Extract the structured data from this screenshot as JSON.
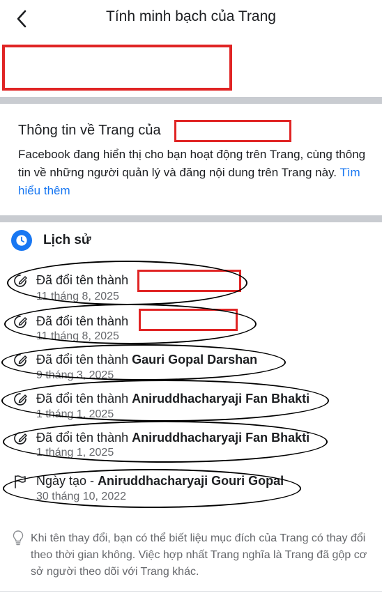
{
  "header": {
    "title": "Tính minh bạch của Trang",
    "back_icon": "chevron-left-icon"
  },
  "page_info": {
    "title_prefix": "Thông tin về Trang của",
    "description": "Facebook đang hiển thị cho bạn hoạt động trên Trang, cùng thông tin về những người quản lý và đăng nội dung trên Trang này.",
    "learn_more": "Tìm hiểu thêm"
  },
  "history": {
    "title": "Lịch sử",
    "icon": "clock-icon",
    "items": [
      {
        "prefix": "Đã đổi tên thành",
        "name": "",
        "date": "11 tháng 8, 2025",
        "icon": "rename-icon"
      },
      {
        "prefix": "Đã đổi tên thành",
        "name": "",
        "date": "11 tháng 8, 2025",
        "icon": "rename-icon"
      },
      {
        "prefix": "Đã đổi tên thành",
        "name": "Gauri Gopal Darshan",
        "date": "9 tháng 3, 2025",
        "icon": "rename-icon"
      },
      {
        "prefix": "Đã đổi tên thành",
        "name": "Aniruddhacharyaji Fan Bhakti",
        "date": "1 tháng 1, 2025",
        "icon": "rename-icon"
      },
      {
        "prefix": "Đã đổi tên thành",
        "name": "Aniruddhacharyaji Fan Bhakti",
        "date": "1 tháng 1, 2025",
        "icon": "rename-icon"
      },
      {
        "prefix": "Ngày tạo -",
        "name": "Aniruddhacharyaji Gouri Gopal",
        "date": "30 tháng 10, 2022",
        "icon": "flag-icon"
      }
    ]
  },
  "tip": {
    "icon": "lightbulb-icon",
    "text": "Khi tên thay đổi, bạn có thể biết liệu mục đích của Trang có thay đổi theo thời gian không. Việc hợp nhất Trang nghĩa là Trang đã gộp cơ sở người theo dõi với Trang khác."
  },
  "colors": {
    "accent": "#1877f2",
    "redaction": "#e02424",
    "divider": "#c9ccd1",
    "secondary_text": "#65676b"
  }
}
